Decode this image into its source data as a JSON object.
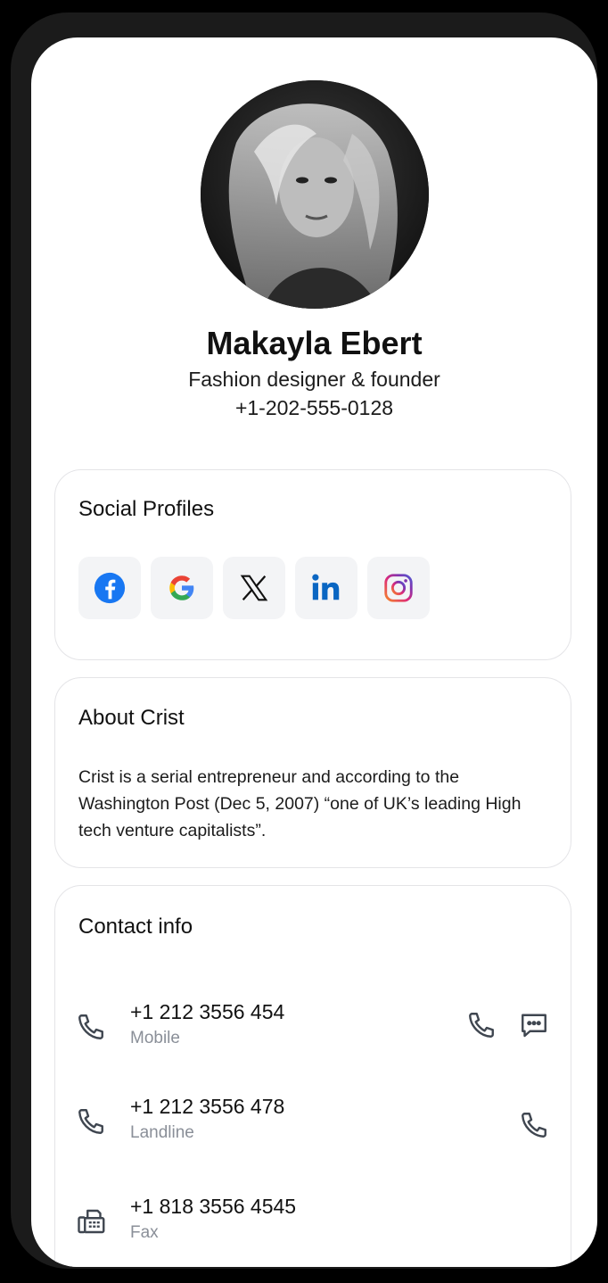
{
  "profile": {
    "name": "Makayla Ebert",
    "title": "Fashion designer & founder",
    "phone": "+1-202-555-0128"
  },
  "social": {
    "title": "Social Profiles",
    "items": [
      {
        "name": "facebook",
        "icon": "facebook-icon",
        "color": "#1877F2"
      },
      {
        "name": "google",
        "icon": "google-icon",
        "color": "#4285F4"
      },
      {
        "name": "x",
        "icon": "x-icon",
        "color": "#111111"
      },
      {
        "name": "linkedin",
        "icon": "linkedin-icon",
        "color": "#0A66C2"
      },
      {
        "name": "instagram",
        "icon": "instagram-icon",
        "color": "#C13584"
      }
    ]
  },
  "about": {
    "title": "About Crist",
    "text": "Crist is a serial entrepreneur and according to the Washington Post (Dec 5, 2007) “one of UK’s leading High tech venture capitalists”."
  },
  "contact": {
    "title": "Contact info",
    "items": [
      {
        "number": "+1 212 3556 454",
        "type": "Mobile",
        "icon": "phone-icon",
        "actions": [
          "call-icon",
          "message-icon"
        ]
      },
      {
        "number": "+1 212 3556 478",
        "type": "Landline",
        "icon": "phone-icon",
        "actions": [
          "call-icon"
        ]
      },
      {
        "number": "+1 818 3556 4545",
        "type": "Fax",
        "icon": "fax-icon",
        "actions": []
      }
    ]
  },
  "colors": {
    "card_border": "#e4e4e7",
    "icon_tile": "#f3f4f6",
    "secondary_text": "#8a8f98",
    "icon_stroke": "#3f4650"
  }
}
